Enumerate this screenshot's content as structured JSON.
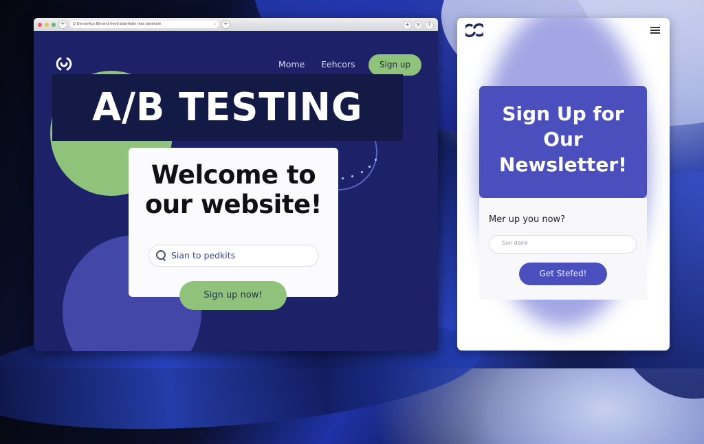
{
  "colors": {
    "desktop_bg": "#1c2168",
    "green_accent": "#8fc27a",
    "purple_accent": "#4a4fbd",
    "banner_bg": "#121a45"
  },
  "banner": {
    "title": "A/B TESTING"
  },
  "desktop": {
    "browser": {
      "url": "Q Qenisefica  Bimand  Ireed bdarfeafs teas barahaie",
      "traffic_lights": [
        "#ee5a5a",
        "#e8c64a",
        "#5fbd5a"
      ],
      "new_tab_icon": "+",
      "right_icons": [
        "+",
        "×",
        "?"
      ]
    },
    "nav": {
      "logo_icon": "logo-icon",
      "home": "Mome",
      "second": "Eehcors",
      "signup": "Sign up"
    },
    "hero": {
      "title": "Welcome to our website!",
      "search_placeholder": "Sian to pedkits",
      "cta": "Sign up now!"
    }
  },
  "mobile": {
    "logo_icon": "logo-icon",
    "menu_icon": "hamburger-icon",
    "newsletter_title": "Sign Up for Our Newsletter!",
    "form_question": "Mer up you now?",
    "input_placeholder": "Son daire",
    "cta": "Get Stefed!"
  }
}
